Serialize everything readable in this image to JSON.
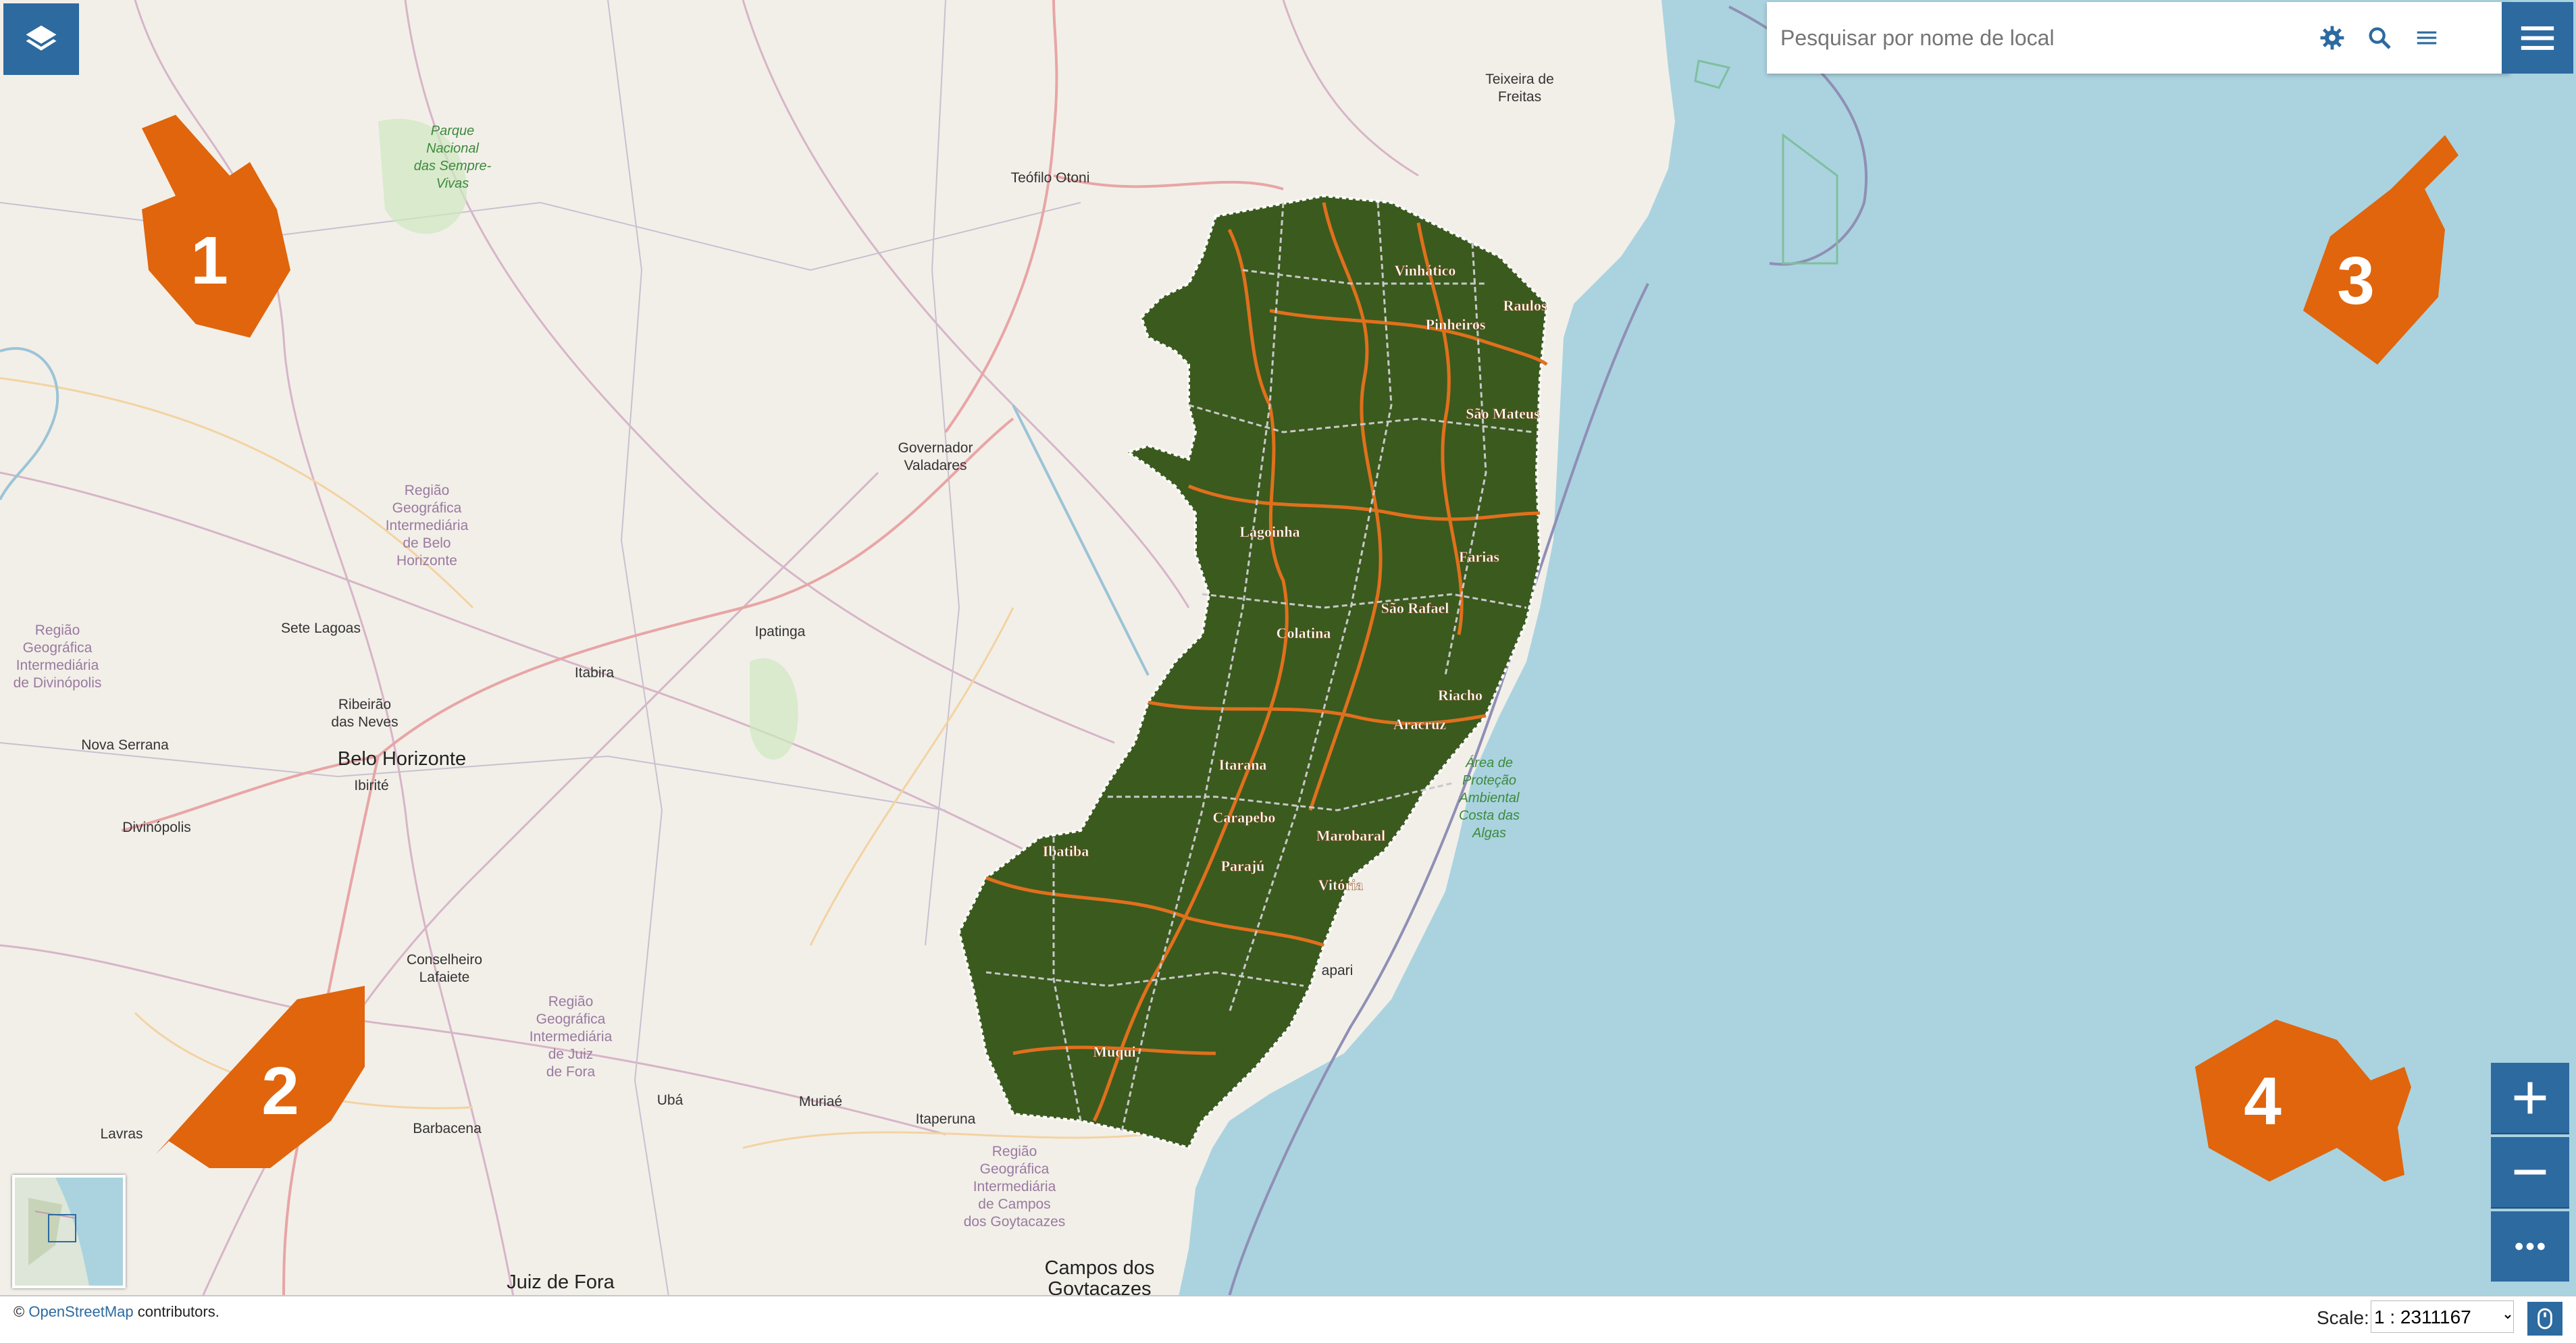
{
  "toolbar": {
    "layers_icon": "layers-icon",
    "search_placeholder": "Pesquisar por nome de local",
    "settings_icon": "gear-icon",
    "search_icon": "search-icon",
    "list_icon": "list-icon",
    "menu_icon": "hamburger-icon"
  },
  "zoom": {
    "in_icon": "plus-icon",
    "out_icon": "minus-icon",
    "more_icon": "ellipsis-icon"
  },
  "footer": {
    "attribution_prefix": "©",
    "attribution_link": "OpenStreetMap",
    "attribution_suffix": " contributors.",
    "scale_label": "Scale:",
    "scale_value": "1 : 2311167",
    "mouse_icon": "mouse-icon"
  },
  "map_labels": {
    "teixeira_1": "Teixeira de",
    "teixeira_2": "Freitas",
    "teofilo": "Teófilo Otoni",
    "governador_1": "Governador",
    "governador_2": "Valadares",
    "ipatinga": "Ipatinga",
    "itabira": "Itabira",
    "sete_lagoas": "Sete Lagoas",
    "ribeirao_1": "Ribeirão",
    "ribeirao_2": "das Neves",
    "belo_horizonte": "Belo Horizonte",
    "ibirite": "Ibirité",
    "nova_serrana": "Nova Serrana",
    "divinopolis": "Divinópolis",
    "conselheiro_1": "Conselheiro",
    "conselheiro_2": "Lafaiete",
    "barbacena": "Barbacena",
    "uba": "Ubá",
    "muriae": "Muriaé",
    "itaperuna": "Itaperuna",
    "lavras": "Lavras",
    "juiz_de_fora": "Juiz de Fora",
    "campos_1": "Campos dos",
    "campos_2": "Goytacazes",
    "marataizes_partial": "apari",
    "park_1": "Parque",
    "park_2": "Nacional",
    "park_3": "das Sempre-",
    "park_4": "Vivas",
    "apa_1": "Área de",
    "apa_2": "Proteção",
    "apa_3": "Ambiental",
    "apa_4": "Costa das",
    "apa_5": "Algas",
    "reg_bh_1": "Região",
    "reg_bh_2": "Geográfica",
    "reg_bh_3": "Intermediária",
    "reg_bh_4": "de Belo",
    "reg_bh_5": "Horizonte",
    "reg_div_1": "Região",
    "reg_div_2": "Geográfica",
    "reg_div_3": "Intermediária",
    "reg_div_4": "de Divinópolis",
    "reg_jf_1": "Região",
    "reg_jf_2": "Geográfica",
    "reg_jf_3": "Intermediária",
    "reg_jf_4": "de Juiz",
    "reg_jf_5": "de Fora",
    "reg_cg_1": "Região",
    "reg_cg_2": "Geográfica",
    "reg_cg_3": "Intermediária",
    "reg_cg_4": "de Campos",
    "reg_cg_5": "dos Goytacazes"
  },
  "municipalities": {
    "vinhatico": "Vinhático",
    "raulos": "Raulos",
    "pinheiros": "Pinheiros",
    "sao_mateus": "São Mateus",
    "lagoinha": "Lagoinha",
    "farias": "Farias",
    "sao_rafael": "São Rafael",
    "colatina": "Colatina",
    "riacho": "Riacho",
    "aracruz": "Aracruz",
    "itarana": "Itarana",
    "carapebo": "Carapebo",
    "ibatiba": "Ibatiba",
    "parajn": "Parajú",
    "marobabal": "Marobaral",
    "vitoria": "Vitória",
    "muqui": "Muqui"
  },
  "callouts": [
    "1",
    "2",
    "3",
    "4"
  ],
  "colors": {
    "ui_blue": "#2c6aa0",
    "ocean": "#aad3df",
    "land": "#f2efe9",
    "forest": "#3b5a1e",
    "boundary_orange": "#e0701c",
    "hand_orange": "#e0650c"
  }
}
